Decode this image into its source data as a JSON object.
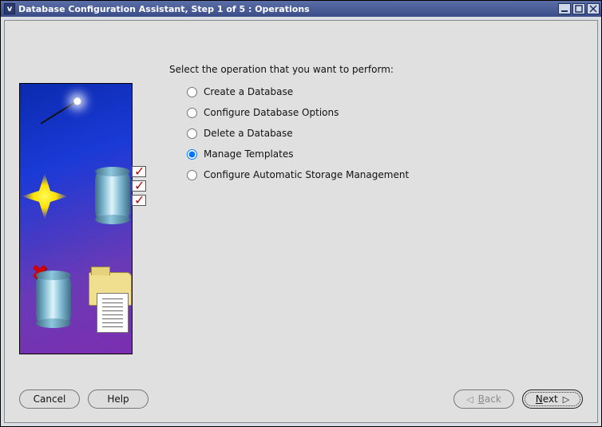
{
  "window": {
    "title": "Database Configuration Assistant, Step 1 of 5 : Operations"
  },
  "prompt": "Select the operation that you want to perform:",
  "options": [
    {
      "label": "Create a Database",
      "selected": false
    },
    {
      "label": "Configure Database Options",
      "selected": false
    },
    {
      "label": "Delete a Database",
      "selected": false
    },
    {
      "label": "Manage Templates",
      "selected": true
    },
    {
      "label": "Configure Automatic Storage Management",
      "selected": false
    }
  ],
  "buttons": {
    "cancel": "Cancel",
    "help": "Help",
    "back_prefix": "B",
    "back_rest": "ack",
    "next_prefix": "N",
    "next_rest": "ext"
  }
}
